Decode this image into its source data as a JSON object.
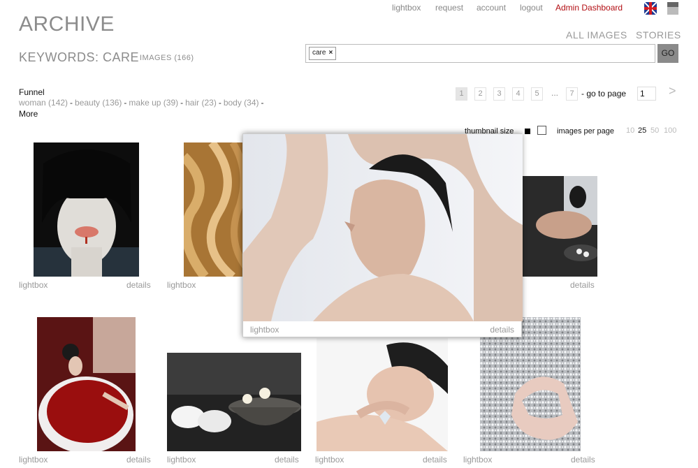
{
  "top_nav": {
    "lightbox": "lightbox",
    "request": "request",
    "account": "account",
    "logout": "logout",
    "admin_dashboard": "Admin Dashboard",
    "admin_color": "#b20e13"
  },
  "header": {
    "title": "ARCHIVE",
    "subtitle": "KEYWORDS: CARE",
    "image_count": "IMAGES (166)"
  },
  "main_nav": {
    "all_images": "ALL IMAGES",
    "stories": "STORIES"
  },
  "search": {
    "tag": "care",
    "tag_remove": "×",
    "value": "",
    "go_label": "GO"
  },
  "funnel": {
    "title": "Funnel",
    "keywords": [
      "woman (142)",
      "beauty (136)",
      "make up (39)",
      "hair (23)",
      "body (34)"
    ],
    "separator": "-",
    "more_label": "More"
  },
  "pagination": {
    "pages": [
      "1",
      "2",
      "3",
      "4",
      "5"
    ],
    "ellipsis": "...",
    "last": "7",
    "current": "1",
    "goto_label": "- go to page",
    "goto_value": "1",
    "next_icon": ">"
  },
  "display": {
    "thumbnail_size_label": "thumbnail size",
    "images_per_page_label": "images per page",
    "per_page_options": [
      "10",
      "25",
      "50",
      "100"
    ],
    "per_page_selected": "25"
  },
  "grid": {
    "lightbox_label": "lightbox",
    "details_label": "details",
    "items": [
      {
        "name": "woman-black-hair"
      },
      {
        "name": "golden-hair"
      },
      {
        "name": "hidden-behind-popup"
      },
      {
        "name": "woman-bath-spa"
      },
      {
        "name": "woman-rose-bath"
      },
      {
        "name": "towels-orchid"
      },
      {
        "name": "woman-diamond-face"
      },
      {
        "name": "hand-diamonds"
      }
    ]
  },
  "popup": {
    "image": "woman-arms-raised",
    "lightbox_label": "lightbox",
    "details_label": "details"
  }
}
